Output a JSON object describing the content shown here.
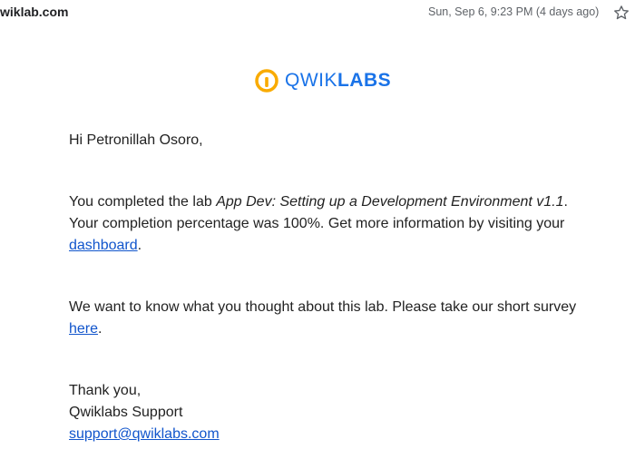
{
  "header": {
    "sender": "wiklab.com",
    "date": "Sun, Sep 6, 9:23 PM (4 days ago)",
    "star_icon": "star-outline-icon"
  },
  "logo": {
    "mark_icon": "qwiklabs-logo-icon",
    "text_part1": "QWIK",
    "text_part2": "LABS",
    "colors": {
      "mark": "#f9ab00",
      "text": "#1a73e8"
    }
  },
  "email": {
    "greeting": "Hi Petronillah Osoro,",
    "completed_prefix": "You completed the lab ",
    "lab_name": "App Dev: Setting up a Development Environment v1.1",
    "completed_suffix": ".",
    "percentage_sentence": " Your completion percentage was 100%. Get more information by visiting your ",
    "dashboard_link": "dashboard",
    "dashboard_suffix": ".",
    "survey_text": "We want to know what you thought about this lab. Please take our short survey ",
    "survey_link": "here",
    "survey_suffix": ".",
    "thanks": "Thank you,",
    "signature": "Qwiklabs Support",
    "support_email": "support@qwiklabs.com"
  },
  "colors": {
    "link": "#1155cc",
    "text": "#222222",
    "meta": "#5f6368"
  }
}
